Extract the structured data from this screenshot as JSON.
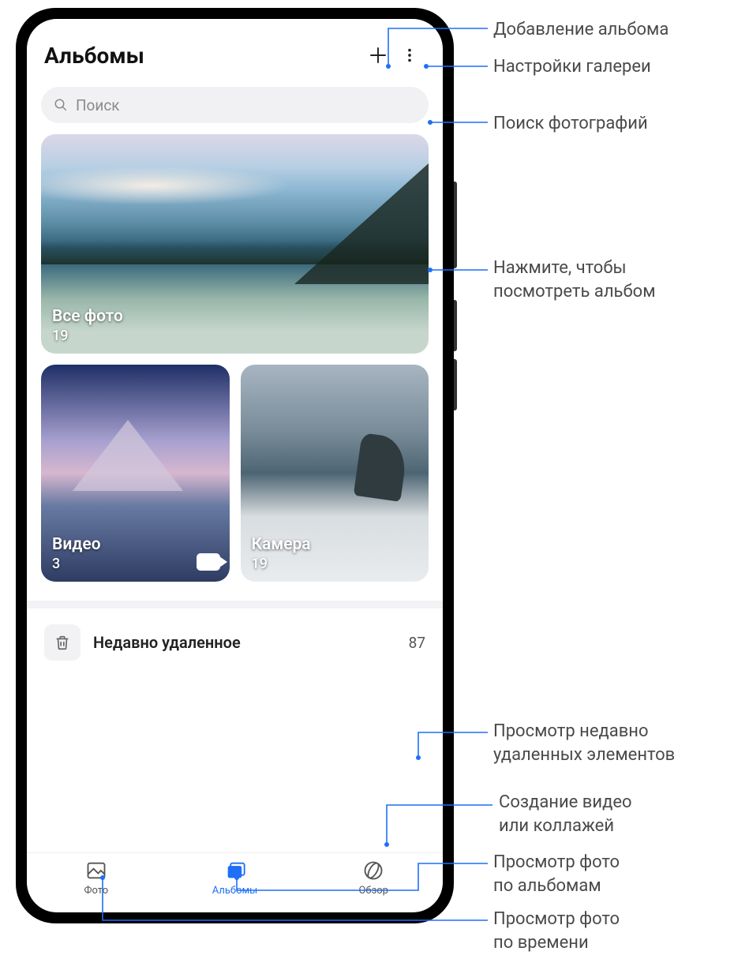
{
  "header": {
    "title": "Альбомы"
  },
  "search": {
    "placeholder": "Поиск"
  },
  "albums": {
    "all_photos": {
      "name": "Все фото",
      "count": "19"
    },
    "videos": {
      "name": "Видео",
      "count": "3"
    },
    "camera": {
      "name": "Камера",
      "count": "19"
    }
  },
  "deleted": {
    "label": "Недавно удаленное",
    "count": "87"
  },
  "nav": {
    "photos": "Фото",
    "albums": "Альбомы",
    "browse": "Обзор"
  },
  "callouts": {
    "add_album": "Добавление альбома",
    "gallery_settings": "Настройки галереи",
    "search_photos": "Поиск фотографий",
    "tap_album": "Нажмите, чтобы\nпосмотреть альбом",
    "recently_deleted": "Просмотр недавно\nудаленных элементов",
    "create_video": "Создание видео\nили коллажей",
    "by_albums": "Просмотр фото\nпо альбомам",
    "by_time": "Просмотр фото\nпо времени"
  }
}
